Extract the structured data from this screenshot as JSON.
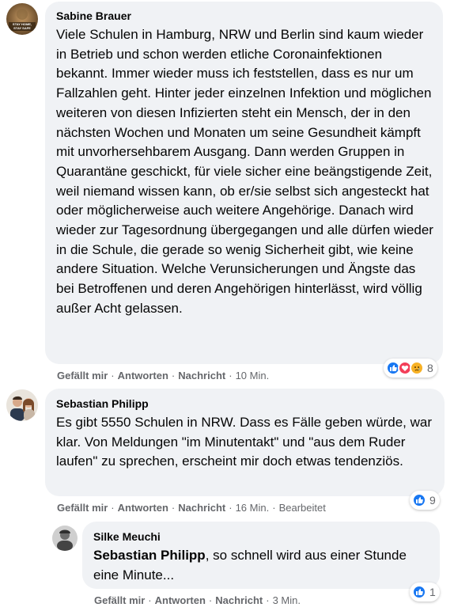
{
  "comments": [
    {
      "author": "Sabine Brauer",
      "avatar_badge": "STAY HOME, STAY SAFE",
      "text": "Viele Schulen in Hamburg, NRW und Berlin sind kaum wieder in Betrieb und schon werden etliche Coronainfektionen bekannt. Immer wieder muss ich feststellen, dass es nur um Fallzahlen geht. Hinter jeder einzelnen Infektion und möglichen weiteren von diesen Infizierten steht ein Mensch, der in den nächsten Wochen und Monaten um seine Gesundheit kämpft mit unvorhersehbarem Ausgang. Dann werden Gruppen in Quarantäne geschickt, für viele sicher eine beängstigende Zeit, weil niemand wissen kann, ob er/sie selbst sich angesteckt hat oder möglicherweise auch weitere Angehörige. Danach wird wieder zur Tagesordnung übergegangen und alle dürfen wieder in die Schule, die gerade so wenig Sicherheit gibt, wie keine andere Situation. Welche Verunsicherungen und Ängste das bei Betroffenen und deren Angehörigen hinterlässt, wird völlig außer Acht gelassen.",
      "like_label": "Gefällt mir",
      "reply_label": "Antworten",
      "message_label": "Nachricht",
      "time": "10 Min.",
      "reaction_icons": [
        "like-icon",
        "love-icon",
        "sad-icon"
      ],
      "reaction_count": "8"
    },
    {
      "author": "Sebastian Philipp",
      "text": "Es gibt 5550 Schulen in NRW. Dass es Fälle geben würde, war klar. Von Meldungen \"im Minutentakt\" und \"aus dem Ruder laufen\" zu sprechen, erscheint mir doch etwas tendenziös.",
      "like_label": "Gefällt mir",
      "reply_label": "Antworten",
      "message_label": "Nachricht",
      "time": "16 Min.",
      "edited_label": "Bearbeitet",
      "reaction_icons": [
        "like-icon"
      ],
      "reaction_count": "9"
    },
    {
      "author": "Silke Meuchi",
      "mention": "Sebastian Philipp",
      "text": ", so schnell wird aus einer Stunde eine Minute...",
      "like_label": "Gefällt mir",
      "reply_label": "Antworten",
      "message_label": "Nachricht",
      "time": "3 Min.",
      "reaction_icons": [
        "like-icon"
      ],
      "reaction_count": "1"
    }
  ],
  "colors": {
    "bubble": "#f0f2f5",
    "like_blue": "#1877f2",
    "love_red": "#f33e58",
    "sad_yellow": "#f7b125",
    "meta_gray": "#65676b"
  }
}
